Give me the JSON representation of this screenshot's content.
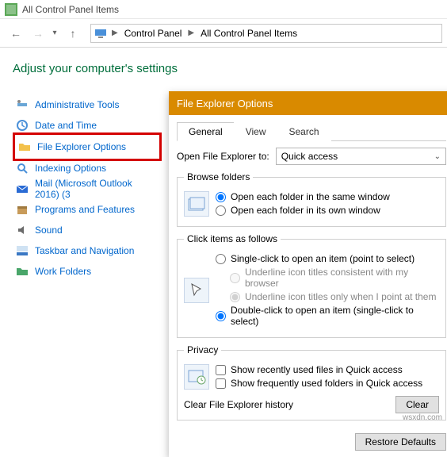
{
  "titlebar": {
    "title": "All Control Panel Items"
  },
  "nav": {
    "crumbs": [
      "Control Panel",
      "All Control Panel Items"
    ]
  },
  "heading": "Adjust your computer's settings",
  "items": [
    {
      "label": "Administrative Tools",
      "icon": "tools-icon"
    },
    {
      "label": "Date and Time",
      "icon": "clock-icon"
    },
    {
      "label": "File Explorer Options",
      "icon": "folder-icon",
      "highlight": true
    },
    {
      "label": "Indexing Options",
      "icon": "search-icon"
    },
    {
      "label": "Mail (Microsoft Outlook 2016) (3",
      "icon": "mail-icon"
    },
    {
      "label": "Programs and Features",
      "icon": "box-icon"
    },
    {
      "label": "Sound",
      "icon": "speaker-icon"
    },
    {
      "label": "Taskbar and Navigation",
      "icon": "taskbar-icon"
    },
    {
      "label": "Work Folders",
      "icon": "workfolder-icon"
    }
  ],
  "dialog": {
    "title": "File Explorer Options",
    "tabs": [
      "General",
      "View",
      "Search"
    ],
    "active_tab": 0,
    "open_label": "Open File Explorer to:",
    "open_value": "Quick access",
    "browse": {
      "legend": "Browse folders",
      "same": "Open each folder in the same window",
      "own": "Open each folder in its own window"
    },
    "click": {
      "legend": "Click items as follows",
      "single": "Single-click to open an item (point to select)",
      "underline_browser": "Underline icon titles consistent with my browser",
      "underline_point": "Underline icon titles only when I point at them",
      "double": "Double-click to open an item (single-click to select)"
    },
    "privacy": {
      "legend": "Privacy",
      "recent": "Show recently used files in Quick access",
      "frequent": "Show frequently used folders in Quick access",
      "clear_label": "Clear File Explorer history",
      "clear_button": "Clear"
    },
    "restore": "Restore Defaults"
  },
  "watermark": "wsxdn.com"
}
